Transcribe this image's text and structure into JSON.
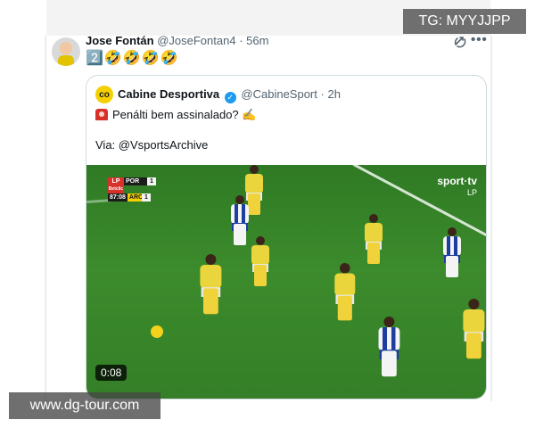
{
  "tweet": {
    "author_name": "Jose Fontán",
    "author_handle": "@JoseFontan4",
    "separator": "·",
    "time": "56m",
    "text": "2️⃣🤣🤣🤣🤣",
    "more_label": "•••"
  },
  "quote": {
    "logo_text": "co",
    "author_name": "Cabine Desportiva",
    "author_handle": "@CabineSport",
    "time": "2h",
    "line1": "Penálti bem assinalado? ✍️",
    "line2": "Via: @VsportsArchive",
    "video": {
      "duration": "0:08",
      "channel_logo": "sport·tv",
      "channel_sub": "LP",
      "scorebug": {
        "league": "LP",
        "sponsor": "Betclic",
        "team_home": "POR",
        "score_home": "1",
        "team_away": "ARO",
        "score_away": "1",
        "clock": "87:08"
      }
    }
  },
  "watermarks": {
    "top": "TG: MYYJJPP",
    "bottom": "www.dg-tour.com"
  },
  "colors": {
    "verified": "#1d9bf0",
    "pitch": "#3c8b2c",
    "home_kit": "#1d3ea0",
    "away_kit": "#ead63c"
  }
}
